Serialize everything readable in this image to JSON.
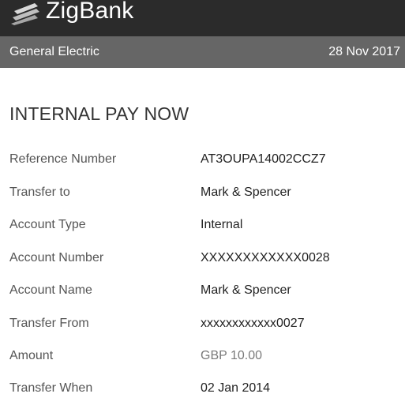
{
  "header": {
    "brand": "ZigBank",
    "logo_icon": "zigbank-stripes-logo"
  },
  "subheader": {
    "company": "General Electric",
    "date": "28 Nov 2017"
  },
  "page": {
    "title": "INTERNAL PAY NOW"
  },
  "details": [
    {
      "label": "Reference Number",
      "value": "AT3OUPA14002CCZ7"
    },
    {
      "label": "Transfer to",
      "value": "Mark & Spencer"
    },
    {
      "label": "Account Type",
      "value": "Internal"
    },
    {
      "label": "Account Number",
      "value": "XXXXXXXXXXXX0028"
    },
    {
      "label": "Account Name",
      "value": "Mark & Spencer"
    },
    {
      "label": "Transfer From",
      "value": "xxxxxxxxxxxx0027"
    },
    {
      "label": "Amount",
      "value": "GBP 10.00"
    },
    {
      "label": "Transfer When",
      "value": "02 Jan 2014"
    }
  ]
}
